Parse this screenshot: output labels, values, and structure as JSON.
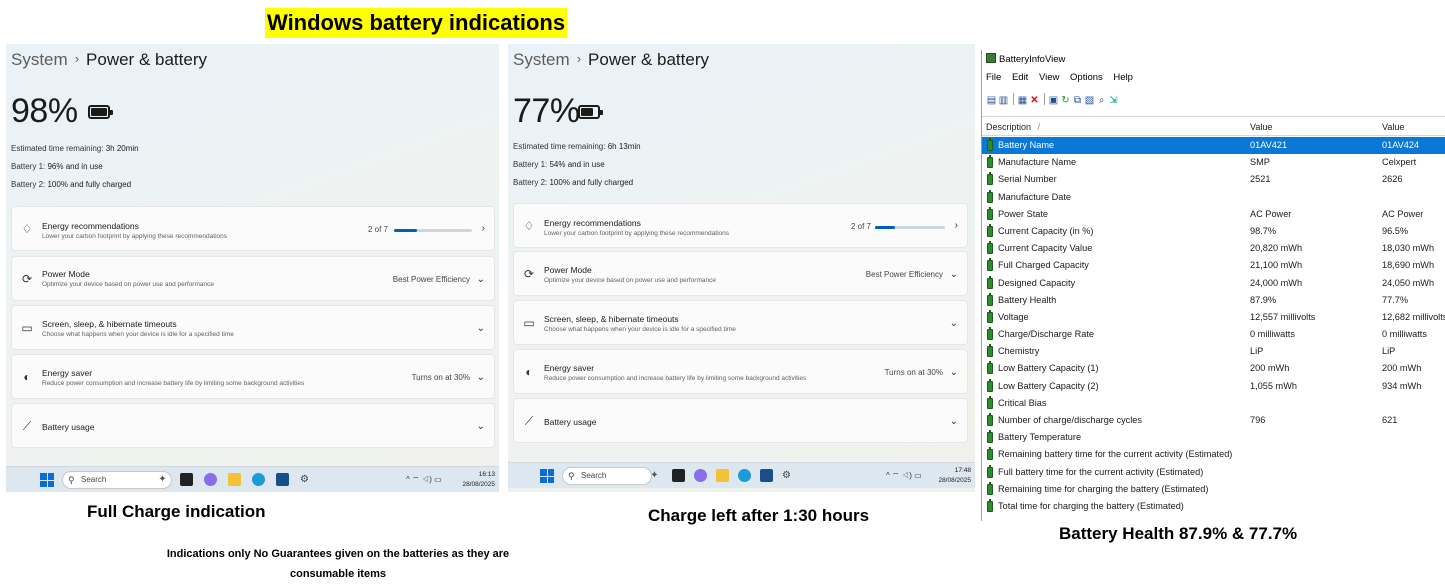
{
  "headline": "Windows battery indications",
  "panels": [
    {
      "breadcrumb": {
        "parent": "System",
        "current": "Power & battery"
      },
      "percent": "98%",
      "battery_fill": 0.98,
      "estimated_label": "Estimated time remaining:",
      "estimated_value": "3h 20min",
      "battery1_label": "Battery 1:",
      "battery1_value": "96% and in use",
      "battery2_label": "Battery 2:",
      "battery2_value": "100% and fully charged",
      "cards": [
        {
          "title": "Energy recommendations",
          "subtitle": "Lower your carbon footprint by applying these recommendations",
          "right": "2 of 7",
          "progress": 0.29
        },
        {
          "title": "Power Mode",
          "subtitle": "Optimize your device based on power use and performance",
          "right": "Best Power Efficiency"
        },
        {
          "title": "Screen, sleep, & hibernate timeouts",
          "subtitle": "Choose what happens when your device is idle for a specified time",
          "right": ""
        },
        {
          "title": "Energy saver",
          "subtitle": "Reduce power consumption and increase battery life by limiting some background activities",
          "right": "Turns on at 30%"
        },
        {
          "title": "Battery usage",
          "subtitle": "",
          "right": ""
        }
      ],
      "taskbar": {
        "search_placeholder": "Search",
        "time": "16:13",
        "date": "28/08/2025"
      },
      "caption": "Full Charge indication"
    },
    {
      "breadcrumb": {
        "parent": "System",
        "current": "Power & battery"
      },
      "percent": "77%",
      "battery_fill": 0.77,
      "estimated_label": "Estimated time remaining:",
      "estimated_value": "6h 13min",
      "battery1_label": "Battery 1:",
      "battery1_value": "54% and in use",
      "battery2_label": "Battery 2:",
      "battery2_value": "100% and fully charged",
      "cards": [
        {
          "title": "Energy recommendations",
          "subtitle": "Lower your carbon footprint by applying these recommendations",
          "right": "2 of 7",
          "progress": 0.29
        },
        {
          "title": "Power Mode",
          "subtitle": "Optimize your device based on power use and performance",
          "right": "Best Power Efficiency"
        },
        {
          "title": "Screen, sleep, & hibernate timeouts",
          "subtitle": "Choose what happens when your device is idle for a specified time",
          "right": ""
        },
        {
          "title": "Energy saver",
          "subtitle": "Reduce power consumption and increase battery life by limiting some background activities",
          "right": "Turns on at 30%"
        },
        {
          "title": "Battery usage",
          "subtitle": "",
          "right": ""
        }
      ],
      "taskbar": {
        "search_placeholder": "Search",
        "time": "17:48",
        "date": "28/08/2025"
      },
      "caption": "Charge left after 1:30 hours"
    }
  ],
  "note": "Indications only No Guarantees given on the batteries as they are consumable items",
  "battery_info_view": {
    "title": "BatteryInfoView",
    "menu": [
      "File",
      "Edit",
      "View",
      "Options",
      "Help"
    ],
    "columns": [
      "Description",
      "Value",
      "Value"
    ],
    "sort_indicator": "/",
    "rows": [
      {
        "description": "Battery Name",
        "value1": "01AV421",
        "value2": "01AV424"
      },
      {
        "description": "Manufacture Name",
        "value1": "SMP",
        "value2": "Celxpert"
      },
      {
        "description": "Serial Number",
        "value1": "2521",
        "value2": "2626"
      },
      {
        "description": "Manufacture Date",
        "value1": "",
        "value2": ""
      },
      {
        "description": "Power State",
        "value1": "AC Power",
        "value2": "AC Power"
      },
      {
        "description": "Current Capacity (in %)",
        "value1": "98.7%",
        "value2": "96.5%"
      },
      {
        "description": "Current Capacity Value",
        "value1": "20,820 mWh",
        "value2": "18,030 mWh"
      },
      {
        "description": "Full Charged Capacity",
        "value1": "21,100 mWh",
        "value2": "18,690 mWh"
      },
      {
        "description": "Designed Capacity",
        "value1": "24,000 mWh",
        "value2": "24,050 mWh"
      },
      {
        "description": "Battery Health",
        "value1": "87.9%",
        "value2": "77.7%"
      },
      {
        "description": "Voltage",
        "value1": "12,557 millivolts",
        "value2": "12,682 millivolts"
      },
      {
        "description": "Charge/Discharge Rate",
        "value1": "0 milliwatts",
        "value2": "0 milliwatts"
      },
      {
        "description": "Chemistry",
        "value1": "LiP",
        "value2": "LiP"
      },
      {
        "description": "Low Battery Capacity (1)",
        "value1": "200 mWh",
        "value2": "200 mWh"
      },
      {
        "description": "Low Battery Capacity (2)",
        "value1": "1,055 mWh",
        "value2": "934 mWh"
      },
      {
        "description": "Critical Bias",
        "value1": "",
        "value2": ""
      },
      {
        "description": "Number of charge/discharge cycles",
        "value1": "796",
        "value2": "621"
      },
      {
        "description": "Battery Temperature",
        "value1": "",
        "value2": ""
      },
      {
        "description": "Remaining battery time for the current activity (Estimated)",
        "value1": "",
        "value2": ""
      },
      {
        "description": "Full battery time for the current activity (Estimated)",
        "value1": "",
        "value2": ""
      },
      {
        "description": "Remaining time for charging the battery (Estimated)",
        "value1": "",
        "value2": ""
      },
      {
        "description": "Total  time for charging the battery (Estimated)",
        "value1": "",
        "value2": ""
      }
    ],
    "caption": "Battery Health 87.9% & 77.7%"
  },
  "colors": {
    "accent": "#005fb8",
    "highlight": "#ffff00",
    "selection": "#0a78d7",
    "battery_green": "#2e8b2e"
  }
}
